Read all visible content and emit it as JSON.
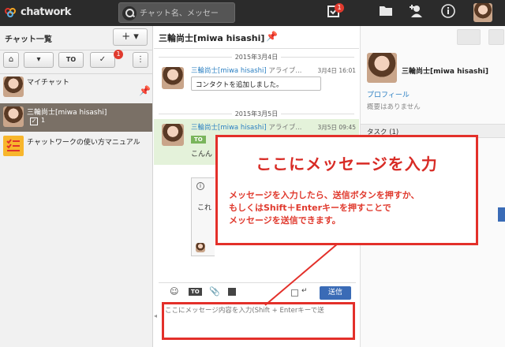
{
  "topbar": {
    "logo_text": "chatwork",
    "search_placeholder": "チャット名、メッセー",
    "tasks_badge": "1"
  },
  "sidebar": {
    "title": "チャット一覧",
    "add_label": "+ ▾",
    "filter_badge": "1",
    "filters": [
      "⌂",
      "▾",
      "TO",
      "✓",
      "⋮"
    ],
    "rooms": [
      {
        "name": "マイチャット"
      },
      {
        "name": "三輪尚士[miwa hisashi]",
        "task_count": "1"
      },
      {
        "name": "チャットワークの使い方マニュアル"
      }
    ]
  },
  "main": {
    "room_title": "三輪尚士[miwa hisashi]",
    "date1": "2015年3月4日",
    "date2": "2015年3月5日",
    "msg1": {
      "name": "三輪尚士[miwa hisashi]",
      "tag": "アライブ...",
      "time": "3月4日 16:01",
      "text": "コンタクトを追加しました。"
    },
    "msg2": {
      "name": "三輪尚士[miwa hisashi]",
      "tag": "アライブ...",
      "time": "3月5日 09:45",
      "to": "TO",
      "preview": "こんん"
    },
    "msg3_preview": "これ"
  },
  "rightpane": {
    "name": "三輪尚士[miwa hisashi]",
    "profile_link": "プロフィール",
    "summary": "概要はありません",
    "task_header": "タスク (1)"
  },
  "composer": {
    "send_label": "送信",
    "placeholder": "ここにメッセージ内容を入力(Shift + Enterキーで送"
  },
  "callout": {
    "title": "ここにメッセージを入力",
    "body_line1": "メッセージを入力したら、送信ボタンを押すか、",
    "body_line2": "もしくはShift＋Enterキーを押すことで",
    "body_line3": "メッセージを送信できます。"
  },
  "colors": {
    "accent_red": "#e3302a",
    "link_blue": "#2a7fc2",
    "send_blue": "#3a6bb6"
  }
}
